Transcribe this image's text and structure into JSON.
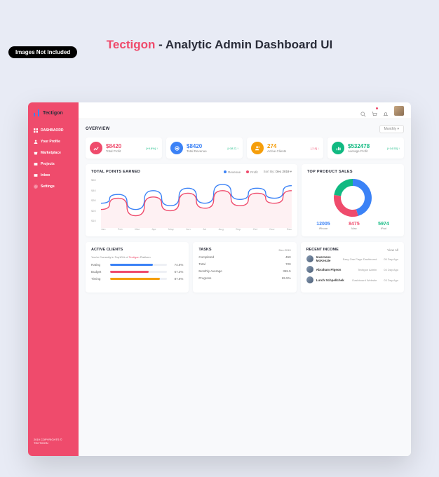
{
  "badge": "Images Not Included",
  "page_title": {
    "brand": "Tectigon",
    "rest": " - Analytic Admin Dashboard UI"
  },
  "brand": "Tectigon",
  "sidebar": {
    "items": [
      {
        "label": "DASHBAORD"
      },
      {
        "label": "Your Profile"
      },
      {
        "label": "Marketplace"
      },
      {
        "label": "Projects"
      },
      {
        "label": "Inbox"
      },
      {
        "label": "Settings"
      }
    ],
    "copyright": "2019 COPYRIGHTS © TECTIGON"
  },
  "overview": {
    "title": "OVERVIEW",
    "filter": "Monthly",
    "stats": [
      {
        "value": "$8420",
        "label": "Total Profit",
        "change": "[+9.8%] ↑"
      },
      {
        "value": "$8420",
        "label": "Total Revenue",
        "change": "[+38.7] ↑"
      },
      {
        "value": "274",
        "label": "Active Clients",
        "change": "[-2.8] ↓"
      },
      {
        "value": "$532478",
        "label": "Average Profit",
        "change": "[+14.53] ↑"
      }
    ]
  },
  "chart_data": {
    "type": "line",
    "title": "TOTAL POINTS EARNED",
    "legend": [
      "Revenue",
      "Profit"
    ],
    "sort_by": "Sort By:",
    "sort_value": "Dec 2019",
    "categories": [
      "Jan",
      "Feb",
      "Mar",
      "Apr",
      "May",
      "Jun",
      "Jul",
      "Aug",
      "Sep",
      "Oct",
      "Nov",
      "Dec"
    ],
    "y_ticks": [
      "$50",
      "$40",
      "$30",
      "$20",
      "$10"
    ],
    "ylim": [
      10,
      50
    ],
    "series": [
      {
        "name": "Revenue",
        "color": "#3b82f6",
        "values": [
          30,
          37,
          25,
          40,
          28,
          42,
          30,
          45,
          33,
          42,
          34,
          44
        ]
      },
      {
        "name": "Profit",
        "color": "#ef4b6c",
        "values": [
          25,
          34,
          20,
          35,
          24,
          38,
          26,
          40,
          28,
          38,
          30,
          40
        ]
      }
    ]
  },
  "donut": {
    "title": "TOP PRODUCT SALES",
    "type": "pie",
    "items": [
      {
        "label": "iPhone",
        "value": 12005,
        "color": "#3b82f6"
      },
      {
        "label": "Mac",
        "value": 8475,
        "color": "#ef4b6c"
      },
      {
        "label": "iPad",
        "value": 5974,
        "color": "#10b981"
      }
    ]
  },
  "active_clients": {
    "title": "ACTIVE CLIENTS",
    "note_pre": "You're Currently in Top10% of ",
    "note_hl": "Tectigon",
    "note_post": " Platform",
    "bars": [
      {
        "label": "Rating",
        "pct": 74.6,
        "color": "blue"
      },
      {
        "label": "Budget",
        "pct": 67.3,
        "color": "pink"
      },
      {
        "label": "Timing",
        "pct": 87.6,
        "color": "orange"
      }
    ]
  },
  "tasks": {
    "title": "TASKS",
    "date": "Dec.2019",
    "rows": [
      {
        "label": "Completed",
        "value": "450"
      },
      {
        "label": "Total",
        "value": "720"
      },
      {
        "label": "Monthly Average",
        "value": "355.5"
      },
      {
        "label": "Progress",
        "value": "65.5%"
      }
    ]
  },
  "income": {
    "title": "RECENT INCOME",
    "view_all": "View All",
    "rows": [
      {
        "name": "Inverness McKenzie",
        "desc": "Easy One Page Dashboard",
        "time": "05 Day Ago"
      },
      {
        "name": "Abraham Pigeon",
        "desc": "Tectigon Admin",
        "time": "04 Day Ago"
      },
      {
        "name": "Lurch Schpellchek",
        "desc": "Dashboard Website",
        "time": "03 Day Ago"
      }
    ]
  }
}
